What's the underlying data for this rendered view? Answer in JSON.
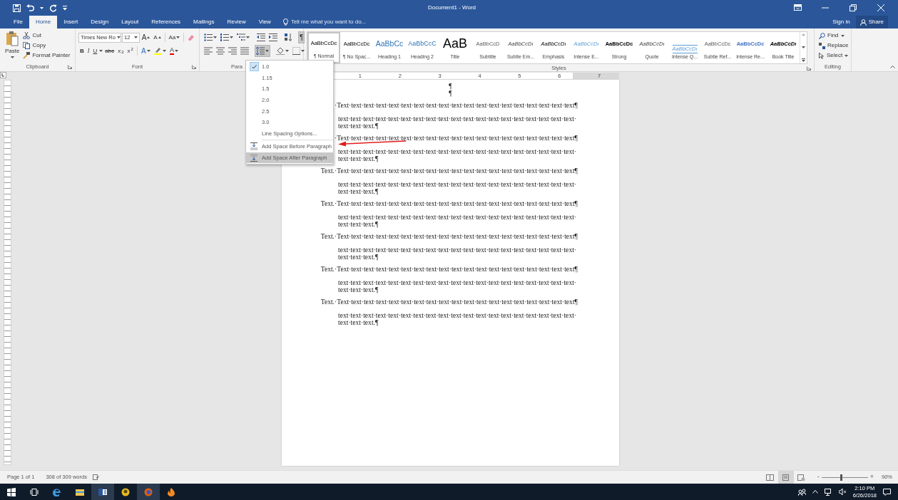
{
  "window": {
    "title": "Document1 - Word"
  },
  "tabs": [
    {
      "label": "File",
      "selected": false
    },
    {
      "label": "Home",
      "selected": true
    },
    {
      "label": "Insert",
      "selected": false
    },
    {
      "label": "Design",
      "selected": false
    },
    {
      "label": "Layout",
      "selected": false
    },
    {
      "label": "References",
      "selected": false
    },
    {
      "label": "Mailings",
      "selected": false
    },
    {
      "label": "Review",
      "selected": false
    },
    {
      "label": "View",
      "selected": false
    }
  ],
  "tell_me": {
    "placeholder": "Tell me what you want to do..."
  },
  "account": {
    "sign_in": "Sign in",
    "share": "Share"
  },
  "clipboard": {
    "label": "Clipboard",
    "paste": "Paste",
    "cut": "Cut",
    "copy": "Copy",
    "format_painter": "Format Painter"
  },
  "font": {
    "label": "Font",
    "name": "Times New Ro",
    "size": "12",
    "grow": "A",
    "shrink": "A",
    "change_case": "Aa",
    "format": [
      {
        "kind": "bold",
        "text": "B"
      },
      {
        "kind": "italic",
        "text": "I"
      },
      {
        "kind": "underline",
        "text": "U"
      },
      {
        "kind": "strike",
        "text": "abc"
      },
      {
        "kind": "sub",
        "text": "x$_{2}$"
      },
      {
        "kind": "sup",
        "text": "x$^{2}$"
      }
    ],
    "effects": "A",
    "font_color": "A"
  },
  "paragraph": {
    "label": "Para",
    "show_marks": {
      "text": "¶",
      "pressed": true
    },
    "line_spacing": {
      "open": true
    }
  },
  "styles": {
    "label": "Styles",
    "items": [
      {
        "preview": "AaBbCcDc",
        "label": "¶ Normal",
        "kind": "normal",
        "selected": true
      },
      {
        "preview": "AaBbCcDc",
        "label": "¶ No Spac...",
        "kind": "normal",
        "selected": false
      },
      {
        "preview": "AaBbCc",
        "label": "Heading 1",
        "kind": "heading1",
        "selected": false
      },
      {
        "preview": "AaBbCcC",
        "label": "Heading 2",
        "kind": "heading2",
        "selected": false
      },
      {
        "preview": "AaB",
        "label": "Title",
        "kind": "title",
        "selected": false
      },
      {
        "preview": "AaBbCcD",
        "label": "Subtitle",
        "kind": "subtitle",
        "selected": false
      },
      {
        "preview": "AaBbCcDı",
        "label": "Subtle Em...",
        "kind": "subtle",
        "selected": false
      },
      {
        "preview": "AaBbCcDı",
        "label": "Emphasis",
        "kind": "emphasis",
        "selected": false
      },
      {
        "preview": "AaBbCcDı",
        "label": "Intense E...",
        "kind": "intense",
        "selected": false
      },
      {
        "preview": "AaBbCcDc",
        "label": "Strong",
        "kind": "strong",
        "selected": false
      },
      {
        "preview": "AaBbCcDı",
        "label": "Quote",
        "kind": "subtle",
        "selected": false
      },
      {
        "preview": "AaBbCcDı",
        "label": "Intense Q...",
        "kind": "iquote",
        "selected": false
      },
      {
        "preview": "AaBbCcDc",
        "label": "Subtle Ref...",
        "kind": "sref",
        "selected": false
      },
      {
        "preview": "AaBbCcDc",
        "label": "Intense Re...",
        "kind": "iref",
        "selected": false
      },
      {
        "preview": "AaBbCcDı",
        "label": "Book Title",
        "kind": "book",
        "selected": false
      }
    ]
  },
  "editing": {
    "label": "Editing",
    "find": "Find",
    "replace": "Replace",
    "select": "Select"
  },
  "line_spacing_menu": [
    {
      "kind": "value",
      "label": "1.0",
      "checked": true,
      "hovered": false
    },
    {
      "kind": "value",
      "label": "1.15",
      "checked": false,
      "hovered": false
    },
    {
      "kind": "value",
      "label": "1.5",
      "checked": false,
      "hovered": false
    },
    {
      "kind": "value",
      "label": "2.0",
      "checked": false,
      "hovered": false
    },
    {
      "kind": "value",
      "label": "2.5",
      "checked": false,
      "hovered": false
    },
    {
      "kind": "value",
      "label": "3.0",
      "checked": false,
      "hovered": false
    },
    {
      "kind": "option",
      "label": "Line Spacing Options...",
      "hovered": false
    },
    {
      "kind": "before",
      "label": "Add Space Before Paragraph",
      "hovered": false
    },
    {
      "kind": "after",
      "label": "Add Space After Paragraph",
      "hovered": true
    }
  ],
  "ruler": {
    "numbers": [
      "1",
      "2",
      "3",
      "4",
      "5",
      "6",
      "7"
    ]
  },
  "document": {
    "marks": [
      "¶",
      "¶"
    ],
    "paragraphs": [
      {
        "kind": "hanging",
        "lines": [
          "·Text·text·text·text·text·text·text·text·text·text·text·text·text·text·text·text·text·text·text¶"
        ]
      },
      {
        "kind": "indented",
        "lines": [
          "text·text·text·text·text·text·text·text·text·text·text·text·text·text·text·text·text·text·text·",
          "text·text·text.¶"
        ]
      },
      {
        "kind": "hanging",
        "lines": [
          "·Text·text·text·text·text·text·text·text·text·text·text·text·text·text·text·text·text·text·text¶"
        ]
      },
      {
        "kind": "indented",
        "lines": [
          "text·text·text·text·text·text·text·text·text·text·text·text·text·text·text·text·text·text·text·",
          "text·text·text.¶"
        ]
      },
      {
        "kind": "hanging",
        "lead": "Text.",
        "lines": [
          "·Text·text·text·text·text·text·text·text·text·text·text·text·text·text·text·text·text·text·text¶"
        ]
      },
      {
        "kind": "indented",
        "lines": [
          "text·text·text·text·text·text·text·text·text·text·text·text·text·text·text·text·text·text·text·",
          "text·text·text.¶"
        ]
      },
      {
        "kind": "hanging",
        "lead": "Text.",
        "lines": [
          "·Text·text·text·text·text·text·text·text·text·text·text·text·text·text·text·text·text·text·text¶"
        ]
      },
      {
        "kind": "indented",
        "lines": [
          "text·text·text·text·text·text·text·text·text·text·text·text·text·text·text·text·text·text·text·",
          "text·text·text.¶"
        ]
      },
      {
        "kind": "hanging",
        "lead": "Text.",
        "lines": [
          "·Text·text·text·text·text·text·text·text·text·text·text·text·text·text·text·text·text·text·text¶"
        ]
      },
      {
        "kind": "indented",
        "lines": [
          "text·text·text·text·text·text·text·text·text·text·text·text·text·text·text·text·text·text·text·",
          "text·text·text.¶"
        ]
      },
      {
        "kind": "hanging",
        "lead": "Text.",
        "lines": [
          "·Text·text·text·text·text·text·text·text·text·text·text·text·text·text·text·text·text·text·text¶"
        ]
      },
      {
        "kind": "indented",
        "lines": [
          "text·text·text·text·text·text·text·text·text·text·text·text·text·text·text·text·text·text·text·",
          "text·text·text.¶"
        ]
      },
      {
        "kind": "hanging",
        "lead": "Text.",
        "lines": [
          "·Text·text·text·text·text·text·text·text·text·text·text·text·text·text·text·text·text·text·text¶"
        ]
      },
      {
        "kind": "indented",
        "lines": [
          "text·text·text·text·text·text·text·text·text·text·text·text·text·text·text·text·text·text·text·",
          "text·text·text.¶"
        ]
      }
    ]
  },
  "status_bar": {
    "page": "Page 1 of 1",
    "words": "308 of 309 words",
    "views": [
      {
        "kind": "read",
        "selected": false
      },
      {
        "kind": "print",
        "selected": true
      },
      {
        "kind": "web",
        "selected": false
      }
    ],
    "zoom": {
      "minus": "-",
      "plus": "+",
      "level": 0.42,
      "reading": "90%"
    }
  },
  "taskbar": {
    "items": [
      {
        "kind": "start",
        "active": false
      },
      {
        "kind": "taskview",
        "active": false
      },
      {
        "kind": "edge",
        "active": false
      },
      {
        "kind": "explorer",
        "active": false
      },
      {
        "kind": "word",
        "active": true
      },
      {
        "kind": "badge",
        "active": false
      },
      {
        "kind": "firefox",
        "active": true
      },
      {
        "kind": "flame",
        "active": false
      }
    ],
    "time": "2:10 PM",
    "date": "6/26/2018"
  }
}
